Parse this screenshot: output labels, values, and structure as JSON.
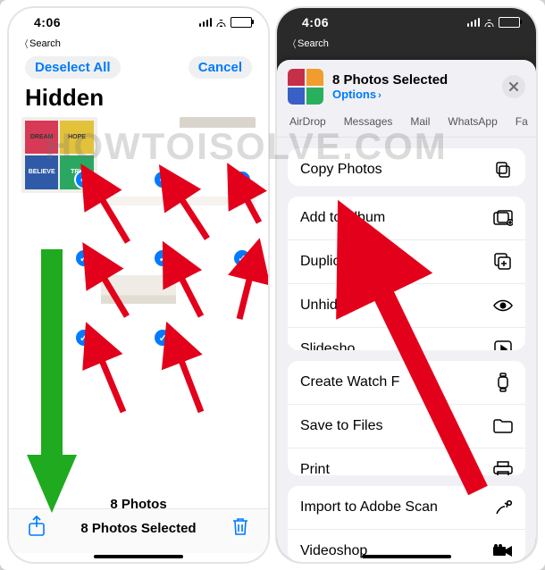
{
  "status": {
    "time": "4:06"
  },
  "back_link": "Search",
  "left": {
    "deselect": "Deselect All",
    "cancel": "Cancel",
    "title": "Hidden",
    "photo_count": "8 Photos",
    "selected": "8 Photos Selected",
    "tiles": {
      "dream": "DREAM",
      "hope": "HOPE",
      "believe": "BELIEVE",
      "try": "TRY"
    }
  },
  "right": {
    "sheet_title": "8 Photos Selected",
    "options": "Options",
    "apps": {
      "airdrop": "AirDrop",
      "messages": "Messages",
      "mail": "Mail",
      "whatsapp": "WhatsApp",
      "fa": "Fa"
    },
    "actions": {
      "copy": "Copy Photos",
      "add": "Add to Album",
      "duplicate": "Duplicate",
      "unhide": "Unhide",
      "slideshow": "Slidesho",
      "watchface": "Create Watch F",
      "save_files": "Save to Files",
      "print": "Print",
      "import_adobe": "Import to Adobe Scan",
      "videoshop": "Videoshop"
    }
  },
  "watermark": "HOWTOISOLVE.COM"
}
